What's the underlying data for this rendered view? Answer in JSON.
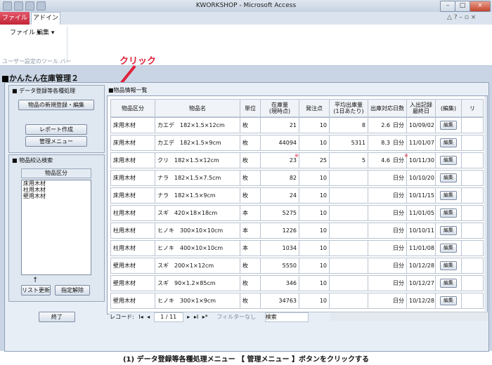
{
  "window": {
    "title": "KWORKSHOP - Microsoft Access",
    "min": "–",
    "max": "□",
    "close": "×"
  },
  "ribbon": {
    "tabs": [
      "ファイル",
      "アドイン"
    ],
    "menus": [
      "ファイル ▾",
      "編集 ▾"
    ],
    "group_label": "ユーザー設定のツール バー",
    "window_controls": "△  ?  –  ▫  ×"
  },
  "form": {
    "title": "かんたん在庫管理２",
    "section1_title": "■ データ登録等各種処理",
    "btn_new": "物品の新規登録・編集",
    "btn_report": "レポート作成",
    "btn_menu": "管理メニュー",
    "section2_title": "■ 物品絞込検索",
    "listbox_header": "物品区分",
    "listbox_items": [
      "床用木材",
      "柱用木材",
      "壁用木材"
    ],
    "arrow": "↑",
    "btn_list_refresh": "リスト更新",
    "btn_clear": "指定解除",
    "btn_exit": "終了",
    "grid_title": "■物品情報一覧"
  },
  "annotation": {
    "click_label": "クリック",
    "accent": "#e0203a"
  },
  "grid": {
    "headers": [
      "物品区分",
      "物品名",
      "単位",
      "在庫量\n(現時点)",
      "発注点",
      "平均出庫量\n(1日あたり)",
      "出庫対応日数",
      "入出記録\n最終日",
      "(編集)",
      "リ"
    ],
    "unit_suffix": "日分",
    "edit_label": "編集",
    "rows": [
      {
        "cat": "床用木材",
        "name": "カエデ　182×1.5×12cm",
        "unit": "枚",
        "stock": "21",
        "order": "10",
        "avg": "8",
        "days": "2.6",
        "date": "10/09/02",
        "mark": false
      },
      {
        "cat": "床用木材",
        "name": "カエデ　182×1.5×9cm",
        "unit": "枚",
        "stock": "44094",
        "order": "10",
        "avg": "5311",
        "days": "8.3",
        "date": "11/01/07",
        "mark": false
      },
      {
        "cat": "床用木材",
        "name": "クリ　182×1.5×12cm",
        "unit": "枚",
        "stock": "23",
        "order": "25",
        "avg": "5",
        "days": "4.6",
        "date": "10/11/30",
        "mark": true
      },
      {
        "cat": "床用木材",
        "name": "ナラ　182×1.5×7.5cm",
        "unit": "枚",
        "stock": "82",
        "order": "10",
        "avg": "",
        "days": "",
        "date": "10/10/20",
        "mark": false
      },
      {
        "cat": "床用木材",
        "name": "ナラ　182×1.5×9cm",
        "unit": "枚",
        "stock": "24",
        "order": "10",
        "avg": "",
        "days": "",
        "date": "10/11/15",
        "mark": false
      },
      {
        "cat": "柱用木材",
        "name": "スギ　420×18×18cm",
        "unit": "本",
        "stock": "5275",
        "order": "10",
        "avg": "",
        "days": "",
        "date": "11/01/05",
        "mark": false
      },
      {
        "cat": "柱用木材",
        "name": "ヒノキ　300×10×10cm",
        "unit": "本",
        "stock": "1226",
        "order": "10",
        "avg": "",
        "days": "",
        "date": "10/10/11",
        "mark": false
      },
      {
        "cat": "柱用木材",
        "name": "ヒノキ　400×10×10cm",
        "unit": "本",
        "stock": "1034",
        "order": "10",
        "avg": "",
        "days": "",
        "date": "11/01/08",
        "mark": false
      },
      {
        "cat": "壁用木材",
        "name": "スギ　200×1×12cm",
        "unit": "枚",
        "stock": "5550",
        "order": "10",
        "avg": "",
        "days": "",
        "date": "10/12/28",
        "mark": false
      },
      {
        "cat": "壁用木材",
        "name": "スギ　90×1.2×85cm",
        "unit": "枚",
        "stock": "346",
        "order": "10",
        "avg": "",
        "days": "",
        "date": "10/12/27",
        "mark": false
      },
      {
        "cat": "壁用木材",
        "name": "ヒノキ　300×1×9cm",
        "unit": "枚",
        "stock": "34763",
        "order": "10",
        "avg": "",
        "days": "",
        "date": "10/12/28",
        "mark": false
      }
    ]
  },
  "navbar": {
    "label": "レコード:",
    "first": "I◂",
    "prev": "◂",
    "position": "1 / 11",
    "next": "▸",
    "last": "▸I",
    "new": "▸*",
    "filter": "フィルターなし",
    "search": "検索"
  },
  "caption": "(1) データ登録等各種処理メニュー 【 管理メニュー 】ボタンをクリックする"
}
